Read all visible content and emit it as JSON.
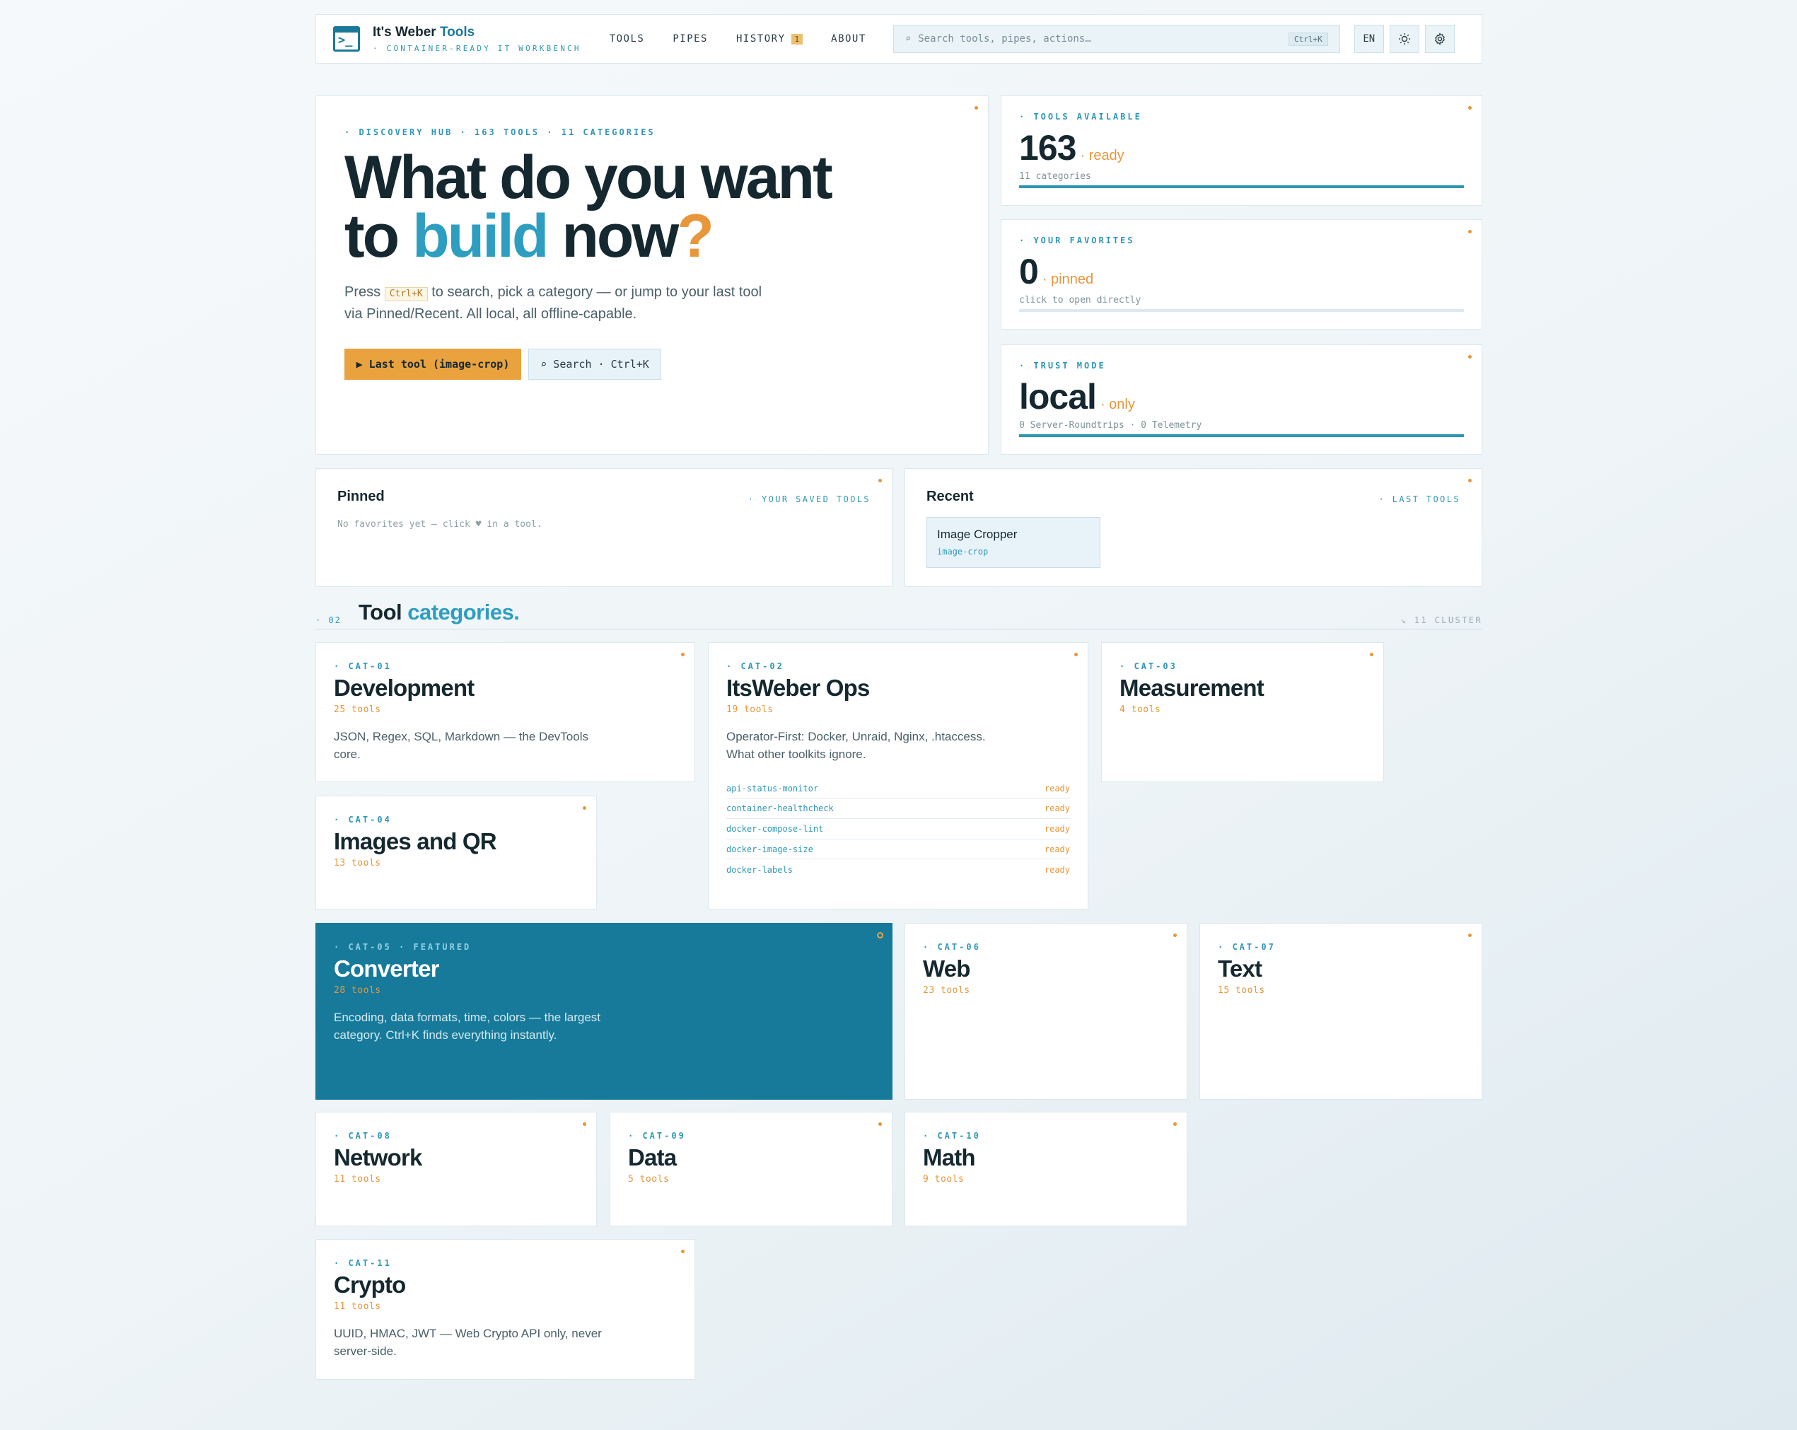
{
  "header": {
    "brand_prefix": "It's Weber ",
    "brand_accent": "Tools",
    "tagline": "· CONTAINER-READY IT WORKBENCH",
    "nav": [
      {
        "label": "TOOLS"
      },
      {
        "label": "PIPES"
      },
      {
        "label": "HISTORY",
        "badge": "1"
      },
      {
        "label": "ABOUT"
      }
    ],
    "search_placeholder": "Search tools, pipes, actions…",
    "search_kbd": "Ctrl+K",
    "lang": "EN"
  },
  "hero": {
    "kicker": "· DISCOVERY HUB · 163 TOOLS · 11 CATEGORIES",
    "title_l1": "What do you want",
    "title_l2a": "to ",
    "title_l2b": "build",
    "title_l2c": " now",
    "title_q": "?",
    "text_a": "Press ",
    "text_kbd": "Ctrl+K",
    "text_b": " to search, pick a category — or jump to your last tool via Pinned/Recent. All local, all offline-capable.",
    "btn_last": "▶ Last tool (image-crop)",
    "btn_search": "⌕ Search · Ctrl+K"
  },
  "stats": [
    {
      "kicker": "· TOOLS AVAILABLE",
      "value": "163",
      "suffix": "· ready",
      "sub": "11 categories",
      "fill": 1.0
    },
    {
      "kicker": "· YOUR FAVORITES",
      "value": "0",
      "suffix": "· pinned",
      "sub": "click to open directly",
      "fill": 0.0
    },
    {
      "kicker": "· TRUST MODE",
      "value": "local",
      "suffix": "· only",
      "sub": "0 Server-Roundtrips · 0 Telemetry",
      "fill": 1.0
    }
  ],
  "pinned": {
    "title": "Pinned",
    "tag": "· YOUR SAVED TOOLS",
    "empty": "No favorites yet — click ♥ in a tool."
  },
  "recent": {
    "title": "Recent",
    "tag": "· LAST TOOLS",
    "item_name": "Image Cropper",
    "item_id": "image-crop"
  },
  "section": {
    "num": "· 02",
    "title_a": "Tool ",
    "title_b": "categories.",
    "right": "↘ 11 CLUSTER"
  },
  "categories": [
    {
      "id": "· CAT-01",
      "name": "Development",
      "count": "25 tools",
      "desc": "JSON, Regex, SQL, Markdown — the DevTools core."
    },
    {
      "id": "· CAT-02",
      "name": "ItsWeber Ops",
      "count": "19 tools",
      "desc": "Operator-First: Docker, Unraid, Nginx, .htaccess. What other toolkits ignore.",
      "tools": [
        {
          "name": "api-status-monitor",
          "status": "ready"
        },
        {
          "name": "container-healthcheck",
          "status": "ready"
        },
        {
          "name": "docker-compose-lint",
          "status": "ready"
        },
        {
          "name": "docker-image-size",
          "status": "ready"
        },
        {
          "name": "docker-labels",
          "status": "ready"
        }
      ]
    },
    {
      "id": "· CAT-03",
      "name": "Measurement",
      "count": "4 tools"
    },
    {
      "id": "· CAT-04",
      "name": "Images and QR",
      "count": "13 tools"
    },
    {
      "id": "· CAT-05 · FEATURED",
      "name": "Converter",
      "count": "28 tools",
      "desc": "Encoding, data formats, time, colors — the largest category. Ctrl+K finds everything instantly."
    },
    {
      "id": "· CAT-06",
      "name": "Web",
      "count": "23 tools"
    },
    {
      "id": "· CAT-07",
      "name": "Text",
      "count": "15 tools"
    },
    {
      "id": "· CAT-08",
      "name": "Network",
      "count": "11 tools"
    },
    {
      "id": "· CAT-09",
      "name": "Data",
      "count": "5 tools"
    },
    {
      "id": "· CAT-10",
      "name": "Math",
      "count": "9 tools"
    },
    {
      "id": "· CAT-11",
      "name": "Crypto",
      "count": "11 tools",
      "desc": "UUID, HMAC, JWT — Web Crypto API only, never server-side."
    }
  ],
  "colors": {
    "accent": "#2e9ec0",
    "brand": "#177a9a",
    "warm": "#e8963a"
  }
}
